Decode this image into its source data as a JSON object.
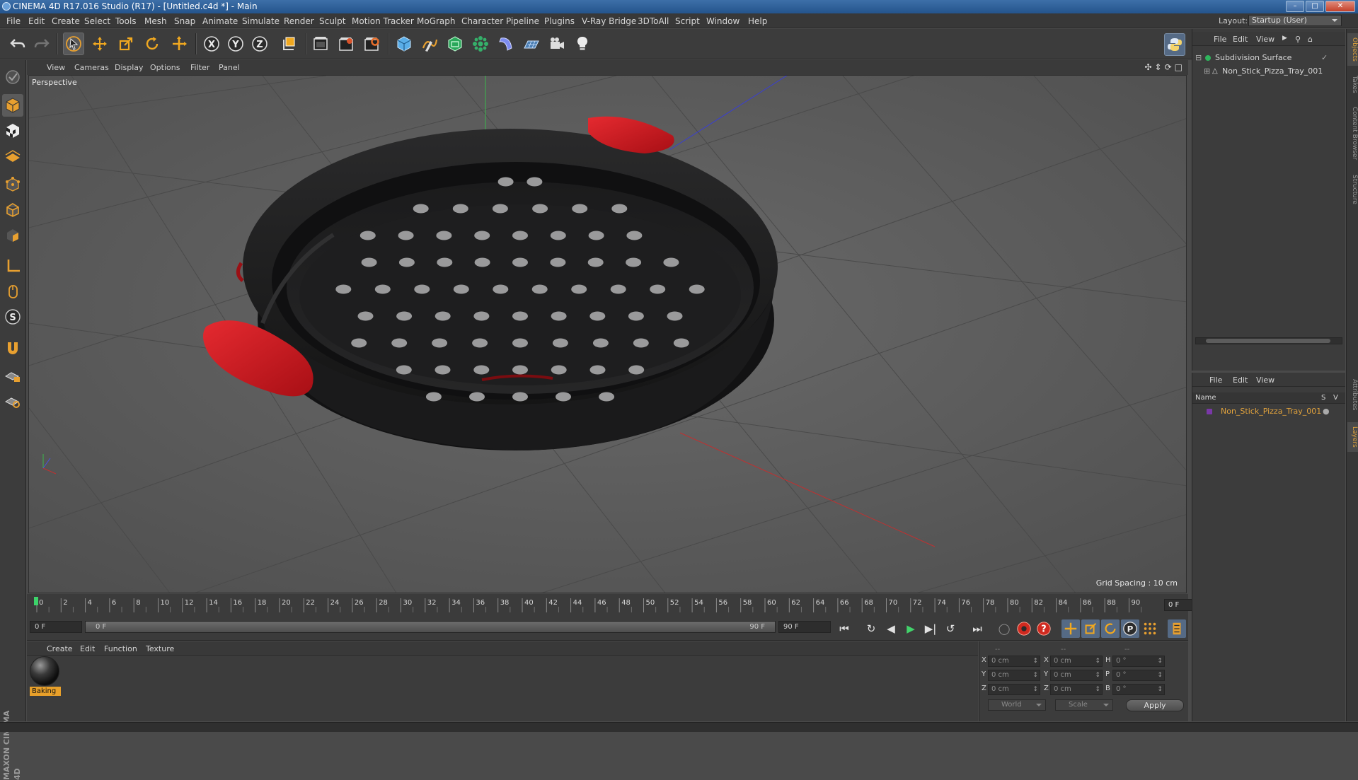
{
  "window": {
    "title": "CINEMA 4D R17.016 Studio (R17) - [Untitled.c4d *] - Main",
    "buttons": [
      "minimize",
      "maximize",
      "close"
    ]
  },
  "menubar": {
    "items": [
      "File",
      "Edit",
      "Create",
      "Select",
      "Tools",
      "Mesh",
      "Snap",
      "Animate",
      "Simulate",
      "Render",
      "Sculpt",
      "Motion Tracker",
      "MoGraph",
      "Character",
      "Pipeline",
      "Plugins",
      "V-Ray Bridge",
      "3DToAll",
      "Script",
      "Window",
      "Help"
    ],
    "layout_label": "Layout:",
    "layout_value": "Startup (User)"
  },
  "toolbar": {
    "icons": [
      "undo-icon",
      "redo-icon",
      "live-selection-icon",
      "move-icon",
      "scale-icon",
      "rotate-icon",
      "recent-tools-icon",
      "x-axis-icon",
      "y-axis-icon",
      "z-axis-icon",
      "coordinate-system-icon",
      "render-view-icon",
      "render-picture-viewer-icon",
      "edit-render-settings-icon",
      "cube-icon",
      "pen-spline-icon",
      "subdivision-surface-icon",
      "array-icon",
      "deformer-icon",
      "floor-icon",
      "camera-icon",
      "light-icon"
    ],
    "axis_labels": [
      "X",
      "Y",
      "Z"
    ]
  },
  "viewport": {
    "menu": [
      "View",
      "Cameras",
      "Display",
      "Options",
      "Filter",
      "Panel"
    ],
    "camera_label": "Perspective",
    "grid_spacing": "Grid Spacing : 10 cm"
  },
  "timeline": {
    "ticks": [
      "0",
      "2",
      "4",
      "6",
      "8",
      "10",
      "12",
      "14",
      "16",
      "18",
      "20",
      "22",
      "24",
      "26",
      "28",
      "30",
      "32",
      "34",
      "36",
      "38",
      "40",
      "42",
      "44",
      "46",
      "48",
      "50",
      "52",
      "54",
      "56",
      "58",
      "60",
      "62",
      "64",
      "66",
      "68",
      "70",
      "72",
      "74",
      "76",
      "78",
      "80",
      "82",
      "84",
      "86",
      "88",
      "90"
    ],
    "current_frame": "0 F"
  },
  "playbar": {
    "start": "0 F",
    "slider_start": "0 F",
    "slider_end": "90 F",
    "end": "90 F"
  },
  "material_manager": {
    "menu": [
      "Create",
      "Edit",
      "Function",
      "Texture"
    ],
    "materials": [
      {
        "name": "Baking"
      }
    ]
  },
  "coordinates": {
    "header": [
      "--",
      "--",
      "--"
    ],
    "rows": [
      {
        "l1": "X",
        "v1": "0 cm",
        "l2": "X",
        "v2": "0 cm",
        "l3": "H",
        "v3": "0 °"
      },
      {
        "l1": "Y",
        "v1": "0 cm",
        "l2": "Y",
        "v2": "0 cm",
        "l3": "P",
        "v3": "0 °"
      },
      {
        "l1": "Z",
        "v1": "0 cm",
        "l2": "Z",
        "v2": "0 cm",
        "l3": "B",
        "v3": "0 °"
      }
    ],
    "mode_select": "World",
    "size_select": "Scale",
    "apply": "Apply"
  },
  "object_manager": {
    "menu": [
      "File",
      "Edit",
      "View"
    ],
    "objects": [
      {
        "name": "Subdivision Surface",
        "level": 0
      },
      {
        "name": "Non_Stick_Pizza_Tray_001",
        "level": 1
      }
    ]
  },
  "layer_manager": {
    "menu": [
      "File",
      "Edit",
      "View"
    ],
    "columns": {
      "name": "Name",
      "s": "S",
      "v": "V"
    },
    "layers": [
      {
        "name": "Non_Stick_Pizza_Tray_001"
      }
    ]
  },
  "side_tabs": [
    "Objects",
    "Takes",
    "Content Browser",
    "Structure",
    "Attributes",
    "Layers"
  ],
  "brand": "MAXON CINEMA 4D",
  "colors": {
    "accent": "#e2a33c",
    "tray_body": "#1d1d1e",
    "handle": "#d31c22",
    "viewport_bg": "#5a5a5a"
  }
}
